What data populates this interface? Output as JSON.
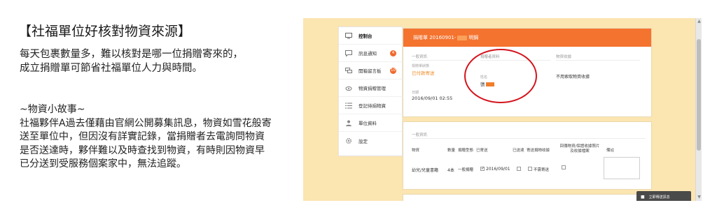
{
  "left": {
    "title": "【社福單位好核對物資來源】",
    "intro_lines": [
      "每天包裹數量多，難以核對是哪一位捐贈寄來的，",
      "成立捐贈單可節省社福單位人力與時間。"
    ],
    "story_heading": "~物資小故事~",
    "story_lines": [
      "社福夥伴A過去僅藉由官網公開募集訊息，物資如雪花般寄",
      "送至單位中，但因沒有詳實記錄，當捐贈者去電詢問物資",
      "是否送達時，夥伴難以及時查找到物資，有時則因物資早",
      "已分送到受服務個案家中，無法追蹤。"
    ]
  },
  "app": {
    "sidebar": [
      {
        "label": "控制台",
        "icon": "monitor-icon",
        "badge": null,
        "active": true
      },
      {
        "label": "訊息通知",
        "icon": "message-icon",
        "badge": "4",
        "active": false
      },
      {
        "label": "開箱留言板",
        "icon": "chat-bubbles-icon",
        "badge": "10",
        "active": false
      },
      {
        "label": "物資捐贈管理",
        "icon": "gift-icon",
        "badge": null,
        "active": false
      },
      {
        "label": "登記待捐物資",
        "icon": "list-icon",
        "badge": null,
        "active": false
      },
      {
        "label": "單位資料",
        "icon": "user-icon",
        "badge": null,
        "active": false
      },
      {
        "label": "設定",
        "icon": "gear-icon",
        "badge": null,
        "active": false
      }
    ],
    "donation": {
      "header_prefix": "捐贈單 20160901-",
      "header_suffix": "明錦",
      "general_label": "一般資訊",
      "method_label": "捐贈單狀態",
      "method_value": "已付款寄送",
      "date_label": "日期",
      "date_value": "2016/09/01 02:55",
      "donor_label": "捐贈者資料",
      "name_label": "姓名",
      "name_value": "張",
      "receipt_label": "物資收據",
      "receipt_value": "不用索取物資收據"
    },
    "items": {
      "section_label": "一般資訊",
      "headers": [
        "物資",
        "數量",
        "捐贈型態",
        "已寄送",
        "已送達",
        "寄送捐物收據",
        "回傳物資/保證收據照片及收據檔案",
        "備註"
      ],
      "row": {
        "name": "幼兒/兒童書籍",
        "qty": "4本",
        "type": "一般捐贈",
        "sent_date": "2016/09/01",
        "arrived_text": "不需寄送"
      }
    },
    "chat_button": "立即傳送訊息",
    "colors": {
      "accent": "#f4732f",
      "page_bg": "#fbe5b0",
      "highlight_circle": "#d4141c"
    }
  }
}
